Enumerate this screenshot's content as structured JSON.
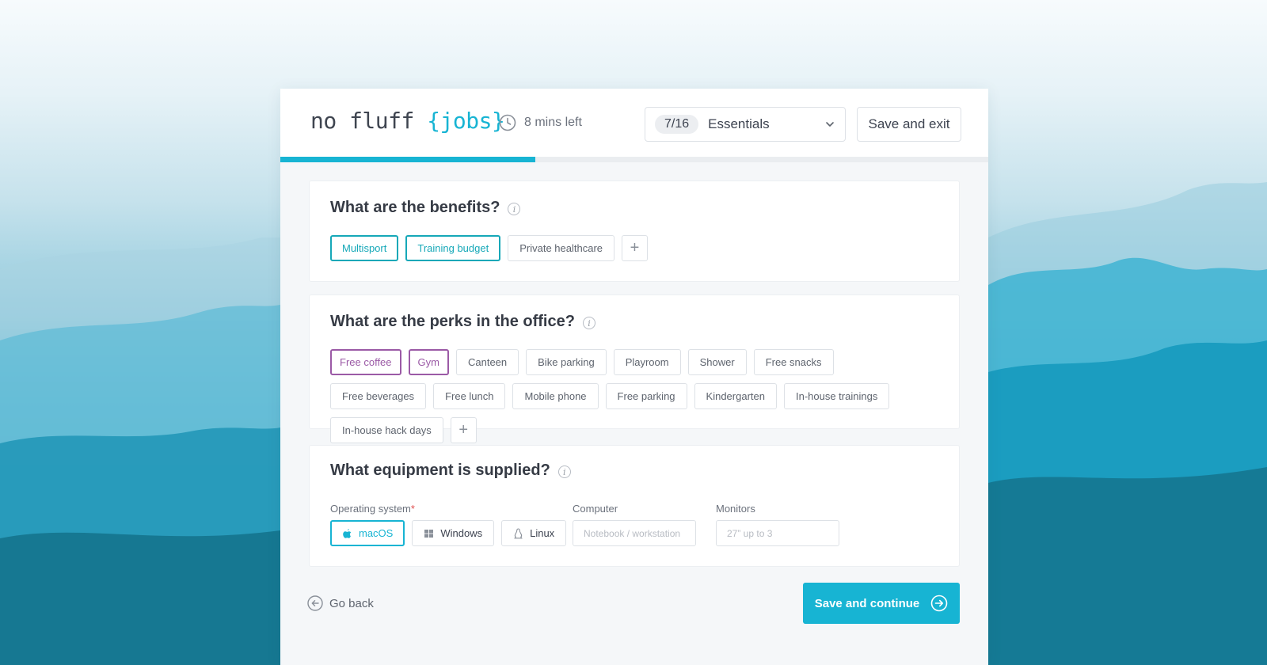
{
  "logo": {
    "text": "no fluff ",
    "accent": "{jobs}"
  },
  "timer": {
    "text": "8 mins left",
    "icon": "clock-icon"
  },
  "step_select": {
    "badge": "7/16",
    "label": "Essentials",
    "icon": "chevron-down-icon"
  },
  "header": {
    "save_exit_label": "Save and exit"
  },
  "progress": {
    "value": 0.36,
    "color": "#17b4d3"
  },
  "benefits": {
    "question": "What are the benefits?",
    "info": "i",
    "items": [
      {
        "label": "Multisport",
        "selected": true
      },
      {
        "label": "Training budget",
        "selected": true
      },
      {
        "label": "Private healthcare",
        "selected": false
      }
    ],
    "add_label": "+"
  },
  "perks": {
    "question": "What are the perks in the office?",
    "info": "i",
    "items": [
      {
        "label": "Free coffee",
        "selected": true
      },
      {
        "label": "Gym",
        "selected": true
      },
      {
        "label": "Canteen",
        "selected": false
      },
      {
        "label": "Bike parking",
        "selected": false
      },
      {
        "label": "Playroom",
        "selected": false
      },
      {
        "label": "Shower",
        "selected": false
      },
      {
        "label": "Free snacks",
        "selected": false
      },
      {
        "label": "Free beverages",
        "selected": false
      },
      {
        "label": "Free lunch",
        "selected": false
      },
      {
        "label": "Mobile phone",
        "selected": false
      },
      {
        "label": "Free parking",
        "selected": false
      },
      {
        "label": "Kindergarten",
        "selected": false
      },
      {
        "label": "In-house trainings",
        "selected": false
      },
      {
        "label": "In-house hack days",
        "selected": false
      }
    ],
    "add_label": "+"
  },
  "equipment": {
    "question": "What equipment is supplied?",
    "info": "i",
    "os_label": "Operating system",
    "os_required_mark": "*",
    "os_options": [
      {
        "label": "macOS",
        "icon": "apple-icon",
        "selected": true
      },
      {
        "label": "Windows",
        "icon": "windows-icon",
        "selected": false
      },
      {
        "label": "Linux",
        "icon": "linux-icon",
        "selected": false
      }
    ],
    "computer_label": "Computer",
    "computer_placeholder": "Notebook / workstation",
    "computer_value": "",
    "monitors_label": "Monitors",
    "monitors_placeholder": "27” up to 3",
    "monitors_value": ""
  },
  "footer": {
    "go_back_label": "Go back",
    "save_continue_label": "Save and continue"
  },
  "colors": {
    "accent": "#17b4d3",
    "benefit_selected": "#16a8b8",
    "perk_selected": "#9b5aa6",
    "required": "#e05050"
  }
}
